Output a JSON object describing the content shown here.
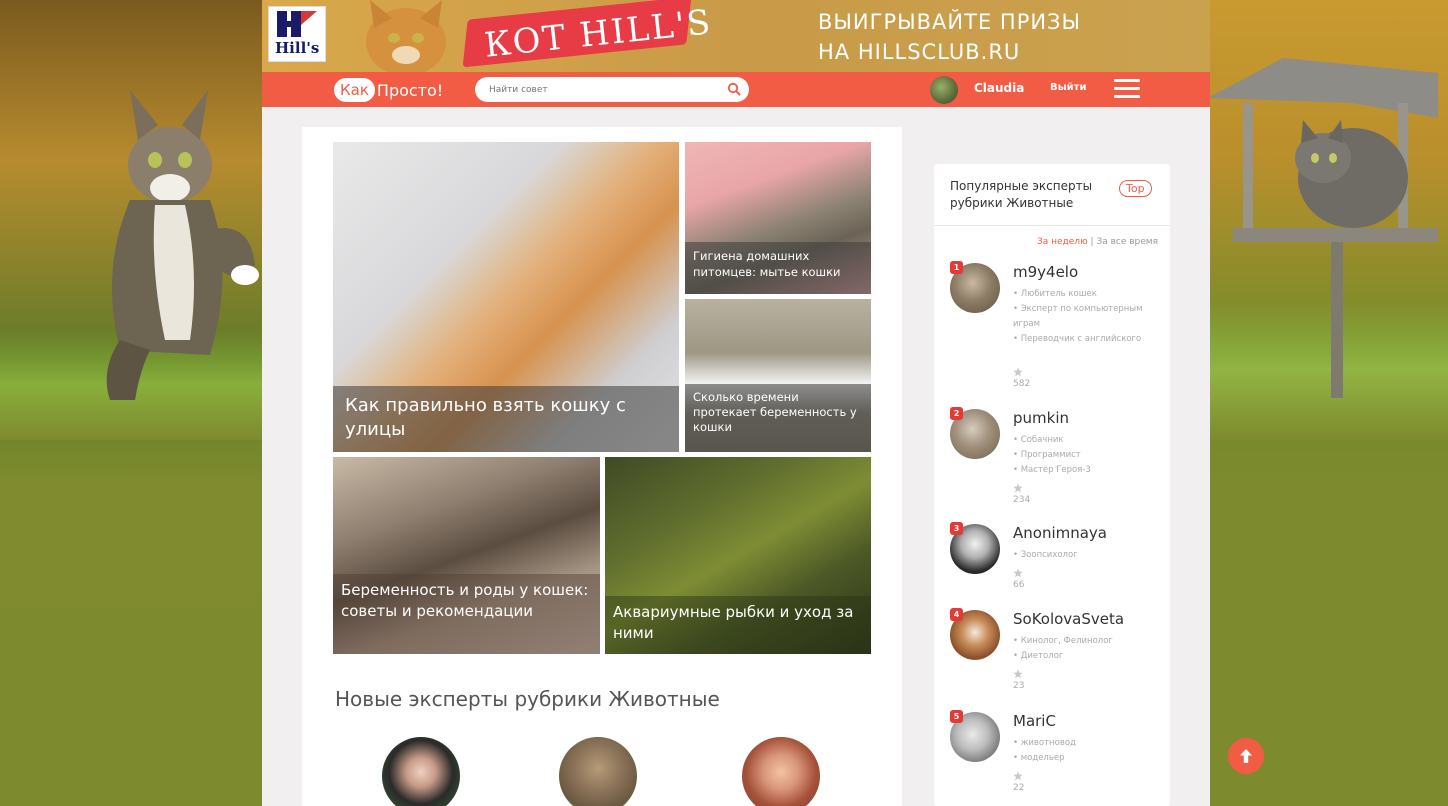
{
  "banner": {
    "brand": "Hill's",
    "ribbon_text": "КОТ HILL'S",
    "promo_line1": "ВЫИГРЫВАЙТЕ ПРИЗЫ",
    "promo_line2": "НА HILLSCLUB.RU"
  },
  "header": {
    "logo_part1": "Как",
    "logo_part2": "Просто!",
    "search_placeholder": "Найти совет",
    "user_name": "Claudia",
    "logout_label": "Выйти",
    "accent_color": "#f25c45"
  },
  "tiles": [
    {
      "caption": "Как правильно взять кошку с улицы"
    },
    {
      "caption": "Гигиена домашних питомцев: мытье кошки"
    },
    {
      "caption": "Сколько времени протекает беременность у кошки"
    },
    {
      "caption": "Беременность и роды у кошек: советы и рекомендации"
    },
    {
      "caption": "Аквариумные рыбки и уход за ними"
    }
  ],
  "new_experts": {
    "title": "Новые эксперты рубрики Животные"
  },
  "sidebar": {
    "title": "Популярные эксперты рубрики Животные",
    "top_badge": "Top",
    "filter_week": "За неделю",
    "filter_separator": "|",
    "filter_all": "За все время",
    "experts": [
      {
        "rank": "1",
        "name": "m9y4elo",
        "tags": [
          "• Любитель кошек",
          "• Эксперт по компьютерным играм",
          "• Переводчик с английского"
        ],
        "score": "582"
      },
      {
        "rank": "2",
        "name": "pumkin",
        "tags": [
          "• Собачник",
          "• Программист",
          "• Мастер Героя-3"
        ],
        "score": "234"
      },
      {
        "rank": "3",
        "name": "Anonimnaya",
        "tags": [
          "• Зоопсихолог"
        ],
        "score": "66"
      },
      {
        "rank": "4",
        "name": "SoKolovaSveta",
        "tags": [
          "• Кинолог, Фелинолог",
          "• Диетолог"
        ],
        "score": "23"
      },
      {
        "rank": "5",
        "name": "MariC",
        "tags": [
          "• животновод",
          "• модельер"
        ],
        "score": "22"
      }
    ]
  }
}
